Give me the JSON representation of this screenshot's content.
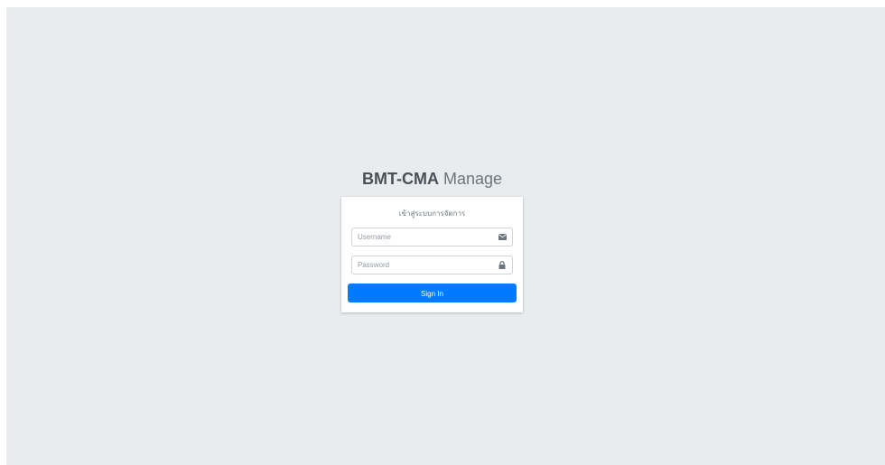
{
  "logo": {
    "bold": "BMT-CMA",
    "light": "Manage"
  },
  "login": {
    "message": "เข้าสู่ระบบการจัดการ",
    "username_placeholder": "Username",
    "password_placeholder": "Password",
    "signin_label": "Sign In"
  },
  "icons": {
    "username": "envelope-icon",
    "password": "lock-icon"
  },
  "colors": {
    "background": "#e9ecef",
    "primary": "#007bff"
  }
}
